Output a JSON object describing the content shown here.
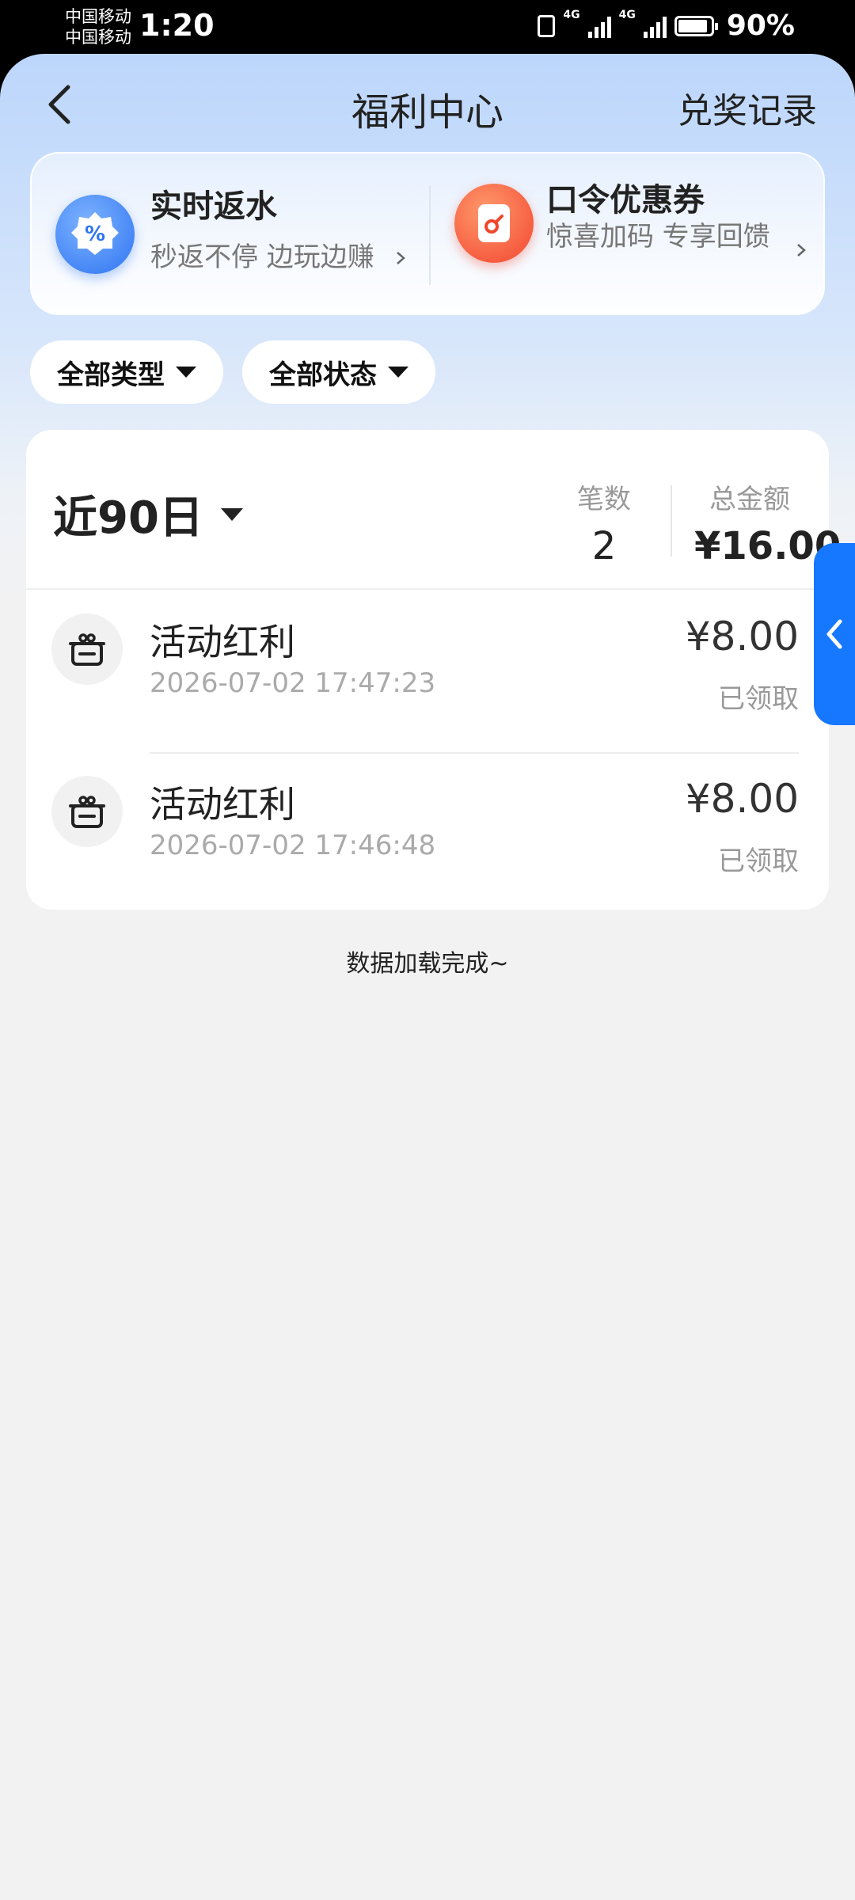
{
  "status_bar": {
    "carrier_1": "中国移动",
    "carrier_2": "中国移动",
    "time": "1:20",
    "network_1": "4G",
    "network_2": "4G",
    "battery_percent": "90%"
  },
  "navbar": {
    "title": "福利中心",
    "right_link": "兑奖记录"
  },
  "promos": [
    {
      "title": "实时返水",
      "subtitle": "秒返不停 边玩边赚",
      "icon": "percent-badge-icon",
      "color": "#2f74f2"
    },
    {
      "title": "口令优惠券",
      "subtitle": "惊喜加码 专享回馈",
      "icon": "coupon-key-icon",
      "color": "#f2452e"
    }
  ],
  "filters": {
    "type_label": "全部类型",
    "status_label": "全部状态"
  },
  "summary": {
    "period_label": "近90日",
    "count_label": "笔数",
    "count_value": "2",
    "total_label": "总金额",
    "total_value": "¥16.00"
  },
  "records": [
    {
      "name": "活动红利",
      "time": "2026-07-02 17:47:23",
      "amount": "¥8.00",
      "status": "已领取",
      "icon": "gift-box-icon"
    },
    {
      "name": "活动红利",
      "time": "2026-07-02 17:46:48",
      "amount": "¥8.00",
      "status": "已领取",
      "icon": "gift-box-icon"
    }
  ],
  "footer": {
    "load_complete": "数据加载完成~"
  },
  "colors": {
    "accent": "#1677ff",
    "background": "#f2f2f2"
  }
}
